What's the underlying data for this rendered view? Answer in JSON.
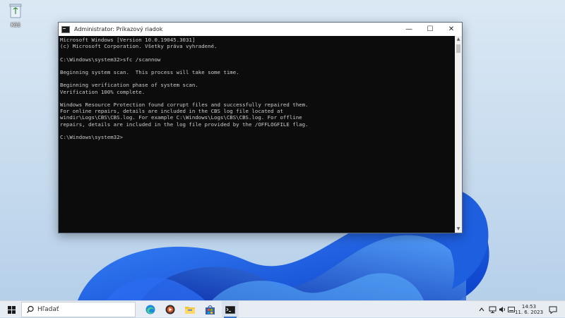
{
  "desktop": {
    "icons": [
      {
        "label": "Kôš",
        "icon": "recycle-bin-icon"
      }
    ]
  },
  "window": {
    "title": "Administrator: Príkazový riadok",
    "icon": "command-prompt-icon",
    "controls": {
      "minimize": "—",
      "maximize": "☐",
      "close": "✕"
    },
    "lines": [
      "Microsoft Windows [Version 10.0.19045.3031]",
      "(c) Microsoft Corporation. Všetky práva vyhradené.",
      "",
      "C:\\Windows\\system32>sfc /scannow",
      "",
      "Beginning system scan.  This process will take some time.",
      "",
      "Beginning verification phase of system scan.",
      "Verification 100% complete.",
      "",
      "Windows Resource Protection found corrupt files and successfully repaired them.",
      "For online repairs, details are included in the CBS log file located at",
      "windir\\Logs\\CBS\\CBS.log. For example C:\\Windows\\Logs\\CBS\\CBS.log. For offline",
      "repairs, details are included in the log file provided by the /OFFLOGFILE flag.",
      "",
      "C:\\Windows\\system32>"
    ]
  },
  "taskbar": {
    "search_placeholder": "Hľadať",
    "apps": [
      "edge-icon",
      "media-player-icon",
      "file-explorer-icon",
      "store-icon",
      "command-prompt-icon"
    ],
    "tray": {
      "time": "14:53",
      "date": "11. 6. 2023"
    }
  },
  "colors": {
    "terminal_bg": "#0c0c0c",
    "terminal_text": "#cccccc",
    "accent": "#0078d4"
  }
}
